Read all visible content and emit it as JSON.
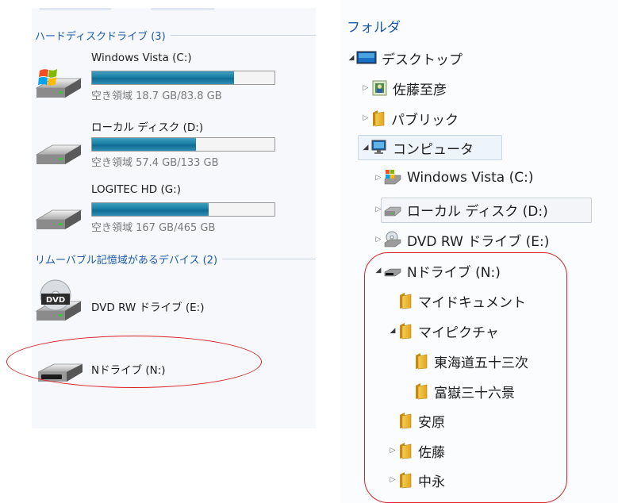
{
  "left": {
    "hard_disk_group": "ハードディスクドライブ (3)",
    "drives": [
      {
        "name": "Windows Vista (C:)",
        "free": "空き領域 18.7 GB/83.8 GB",
        "used_fraction": 0.78,
        "icon": "windows-drive-icon"
      },
      {
        "name": "ローカル ディスク (D:)",
        "free": "空き領域 57.4 GB/133 GB",
        "used_fraction": 0.57,
        "icon": "hard-drive-icon"
      },
      {
        "name": "LOGITEC HD (G:)",
        "free": "空き領域 167 GB/465 GB",
        "used_fraction": 0.64,
        "icon": "hard-drive-icon"
      }
    ],
    "removable_group": "リムーバブル記憶域があるデバイス (2)",
    "removable": [
      {
        "name": "DVD RW ドライブ (E:)",
        "icon": "dvd-drive-icon"
      },
      {
        "name": "Nドライブ (N:)",
        "icon": "usb-drive-icon"
      }
    ]
  },
  "right": {
    "title": "フォルダ",
    "tree": [
      {
        "label": "デスクトップ",
        "icon": "desktop-icon",
        "expand": "open"
      },
      {
        "label": "佐藤至彦",
        "icon": "user-folder-icon",
        "expand": "closed"
      },
      {
        "label": "パブリック",
        "icon": "folder-icon",
        "expand": "closed"
      },
      {
        "label": "コンピュータ",
        "icon": "computer-icon",
        "expand": "open"
      },
      {
        "label": "Windows Vista (C:)",
        "icon": "windows-drive-icon",
        "expand": "closed"
      },
      {
        "label": "ローカル ディスク (D:)",
        "icon": "hard-drive-icon",
        "expand": "closed"
      },
      {
        "label": "DVD RW ドライブ (E:)",
        "icon": "dvd-drive-icon",
        "expand": "closed"
      },
      {
        "label": "Nドライブ (N:)",
        "icon": "usb-drive-icon",
        "expand": "open"
      },
      {
        "label": "マイドキュメント",
        "icon": "folder-icon",
        "expand": "none"
      },
      {
        "label": "マイピクチャ",
        "icon": "folder-icon",
        "expand": "open"
      },
      {
        "label": "東海道五十三次",
        "icon": "folder-icon",
        "expand": "none"
      },
      {
        "label": "富嶽三十六景",
        "icon": "folder-icon",
        "expand": "none"
      },
      {
        "label": "安原",
        "icon": "folder-icon",
        "expand": "none"
      },
      {
        "label": "佐藤",
        "icon": "folder-icon",
        "expand": "closed"
      },
      {
        "label": "中永",
        "icon": "folder-icon",
        "expand": "closed"
      }
    ]
  },
  "colors": {
    "accent": "#1d5aab",
    "annotation": "#d8232a",
    "bar": "#1b7fa6",
    "folder": "#e8b52f"
  }
}
